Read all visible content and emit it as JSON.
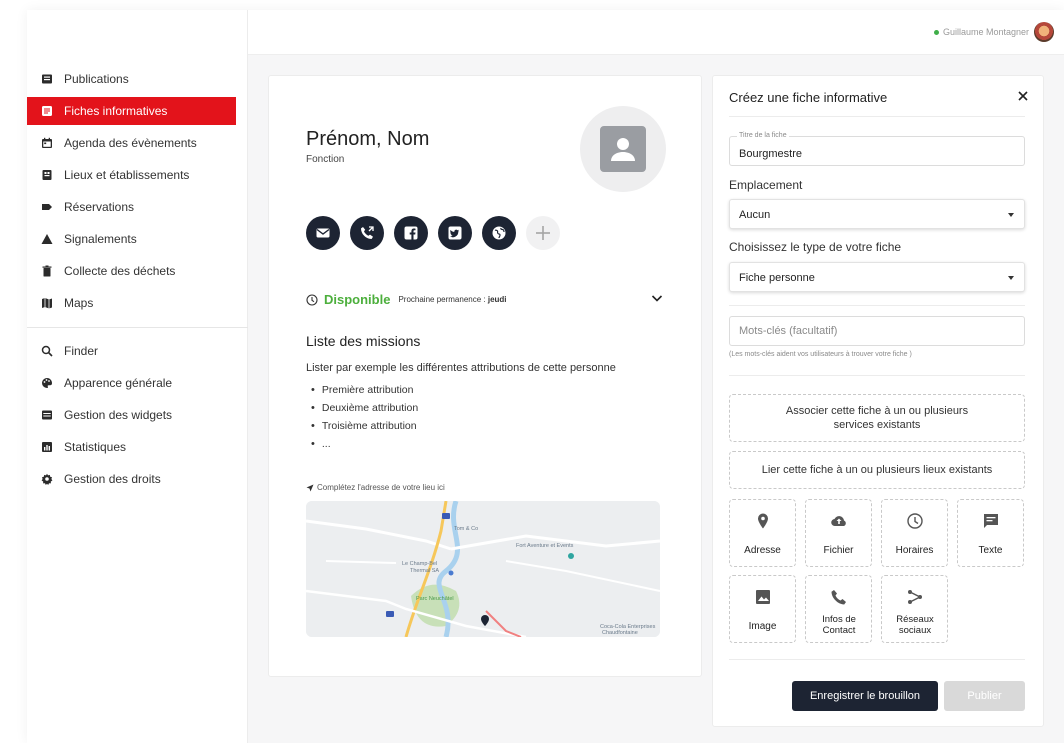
{
  "sidebar": {
    "items": [
      {
        "label": "Publications",
        "icon": "newspaper-icon"
      },
      {
        "label": "Fiches informatives",
        "icon": "list-icon",
        "active": true
      },
      {
        "label": "Agenda des évènements",
        "icon": "calendar-icon"
      },
      {
        "label": "Lieux et établissements",
        "icon": "building-icon"
      },
      {
        "label": "Réservations",
        "icon": "tag-icon"
      },
      {
        "label": "Signalements",
        "icon": "warning-icon"
      },
      {
        "label": "Collecte des déchets",
        "icon": "trash-icon"
      },
      {
        "label": "Maps",
        "icon": "map-icon"
      }
    ],
    "items2": [
      {
        "label": "Finder",
        "icon": "search-icon"
      },
      {
        "label": "Apparence générale",
        "icon": "palette-icon"
      },
      {
        "label": "Gestion des widgets",
        "icon": "widgets-icon"
      },
      {
        "label": "Statistiques",
        "icon": "chart-icon"
      },
      {
        "label": "Gestion des droits",
        "icon": "gear-icon"
      }
    ],
    "accent": "#e3131b"
  },
  "topbar": {
    "user_name": "Guillaume Montagner",
    "status_color": "#3fae49"
  },
  "preview": {
    "name": "Prénom, Nom",
    "function": "Fonction",
    "availability": "Disponible",
    "next_label": "Prochaine permanence :",
    "next_day": "jeudi",
    "missions_title": "Liste des missions",
    "missions_desc": "Lister par exemple les différentes attributions de cette personne",
    "missions": [
      "Première attribution",
      "Deuxième attribution",
      "Troisième attribution",
      "..."
    ],
    "address_hint": "Complétez l'adresse de votre lieu ici",
    "map_labels": {
      "l1": "Tom & Co",
      "l2": "Fort Aventure et Events",
      "l3": "Le Champ-Bel",
      "l4": "Thermal SA",
      "l5": "Parc Neuchâtel",
      "l6": "Coca-Cola Enterprises",
      "l7": "Chaudfontaine"
    }
  },
  "form": {
    "title": "Créez une fiche informative",
    "title_field_legend": "Titre de la fiche",
    "title_field_value": "Bourgmestre",
    "location_label": "Emplacement",
    "location_value": "Aucun",
    "type_label": "Choisissez le type de votre fiche",
    "type_value": "Fiche personne",
    "keywords_placeholder": "Mots-clés (facultatif)",
    "keywords_hint": "(Les mots-clés aident vos utilisateurs à trouver votre fiche )",
    "assoc_services": "Associer cette fiche à un ou plusieurs services existants",
    "link_places": "Lier cette fiche à un ou plusieurs lieux existants",
    "tiles": [
      "Adresse",
      "Fichier",
      "Horaires",
      "Texte",
      "Image",
      "Infos de Contact",
      "Réseaux sociaux"
    ],
    "draft_button": "Enregistrer le brouillon",
    "publish_button": "Publier"
  }
}
